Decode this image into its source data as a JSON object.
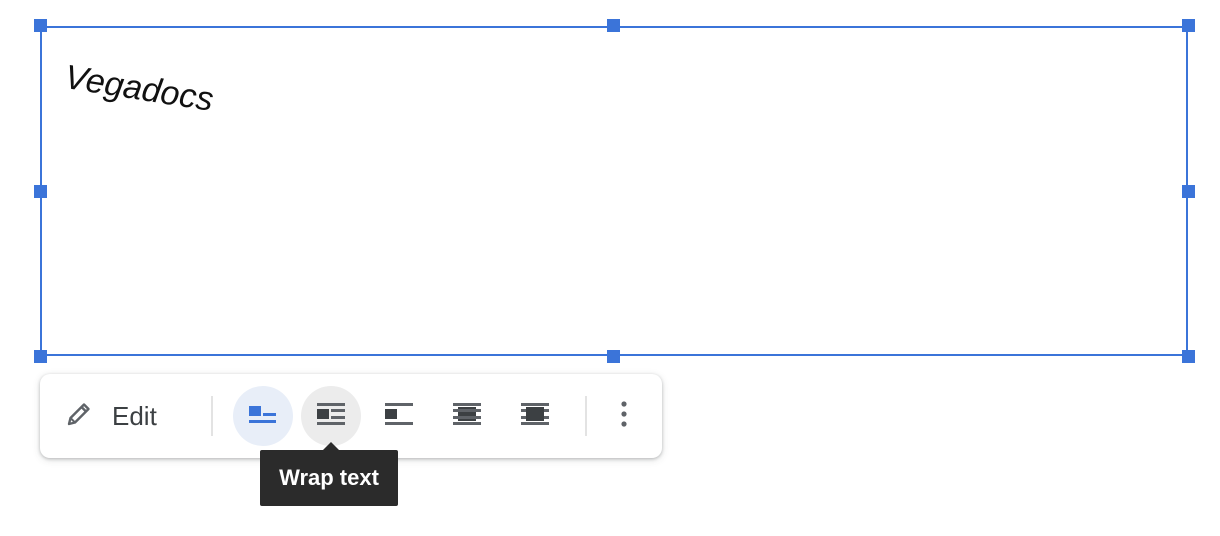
{
  "canvas": {
    "wordart_text": "Vegadocs"
  },
  "toolbar": {
    "edit_label": "Edit",
    "edit_icon": "pencil-icon",
    "wrap_buttons": [
      {
        "name": "inline-icon",
        "state": "active"
      },
      {
        "name": "wrap-text-icon",
        "state": "hover"
      },
      {
        "name": "break-text-icon",
        "state": "normal"
      },
      {
        "name": "behind-text-icon",
        "state": "normal"
      },
      {
        "name": "in-front-of-text-icon",
        "state": "normal"
      }
    ],
    "more_icon": "more-vert-icon"
  },
  "tooltip": {
    "text": "Wrap text"
  },
  "colors": {
    "selection": "#3b74d9",
    "active_icon": "#3b74d9",
    "icon_gray": "#5f6368",
    "tooltip_bg": "#2b2b2b"
  }
}
